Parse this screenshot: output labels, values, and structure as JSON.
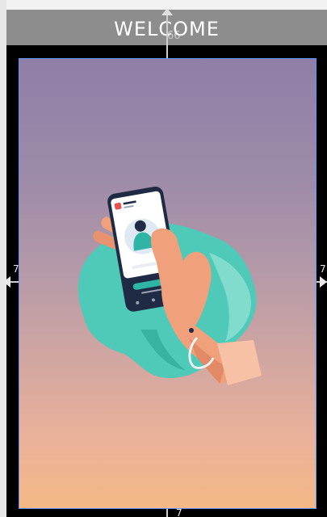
{
  "screen": {
    "title": "WELCOME",
    "title_overlay_number": "66"
  },
  "constraints": {
    "left_value": "7",
    "right_value": "7",
    "bottom_value": "7"
  },
  "illustration": {
    "subject": "hand-holding-phone",
    "colors": {
      "gradient_top": "#8f7fa6",
      "gradient_bottom": "#f3b885",
      "blob": "#4fc9b8",
      "skin": "#f0a07a",
      "phone_dark": "#1f2a44"
    }
  },
  "icons": {
    "top_arrow": "arrow-up-icon",
    "left_arrow": "arrow-left-icon",
    "right_arrow": "arrow-right-icon"
  }
}
